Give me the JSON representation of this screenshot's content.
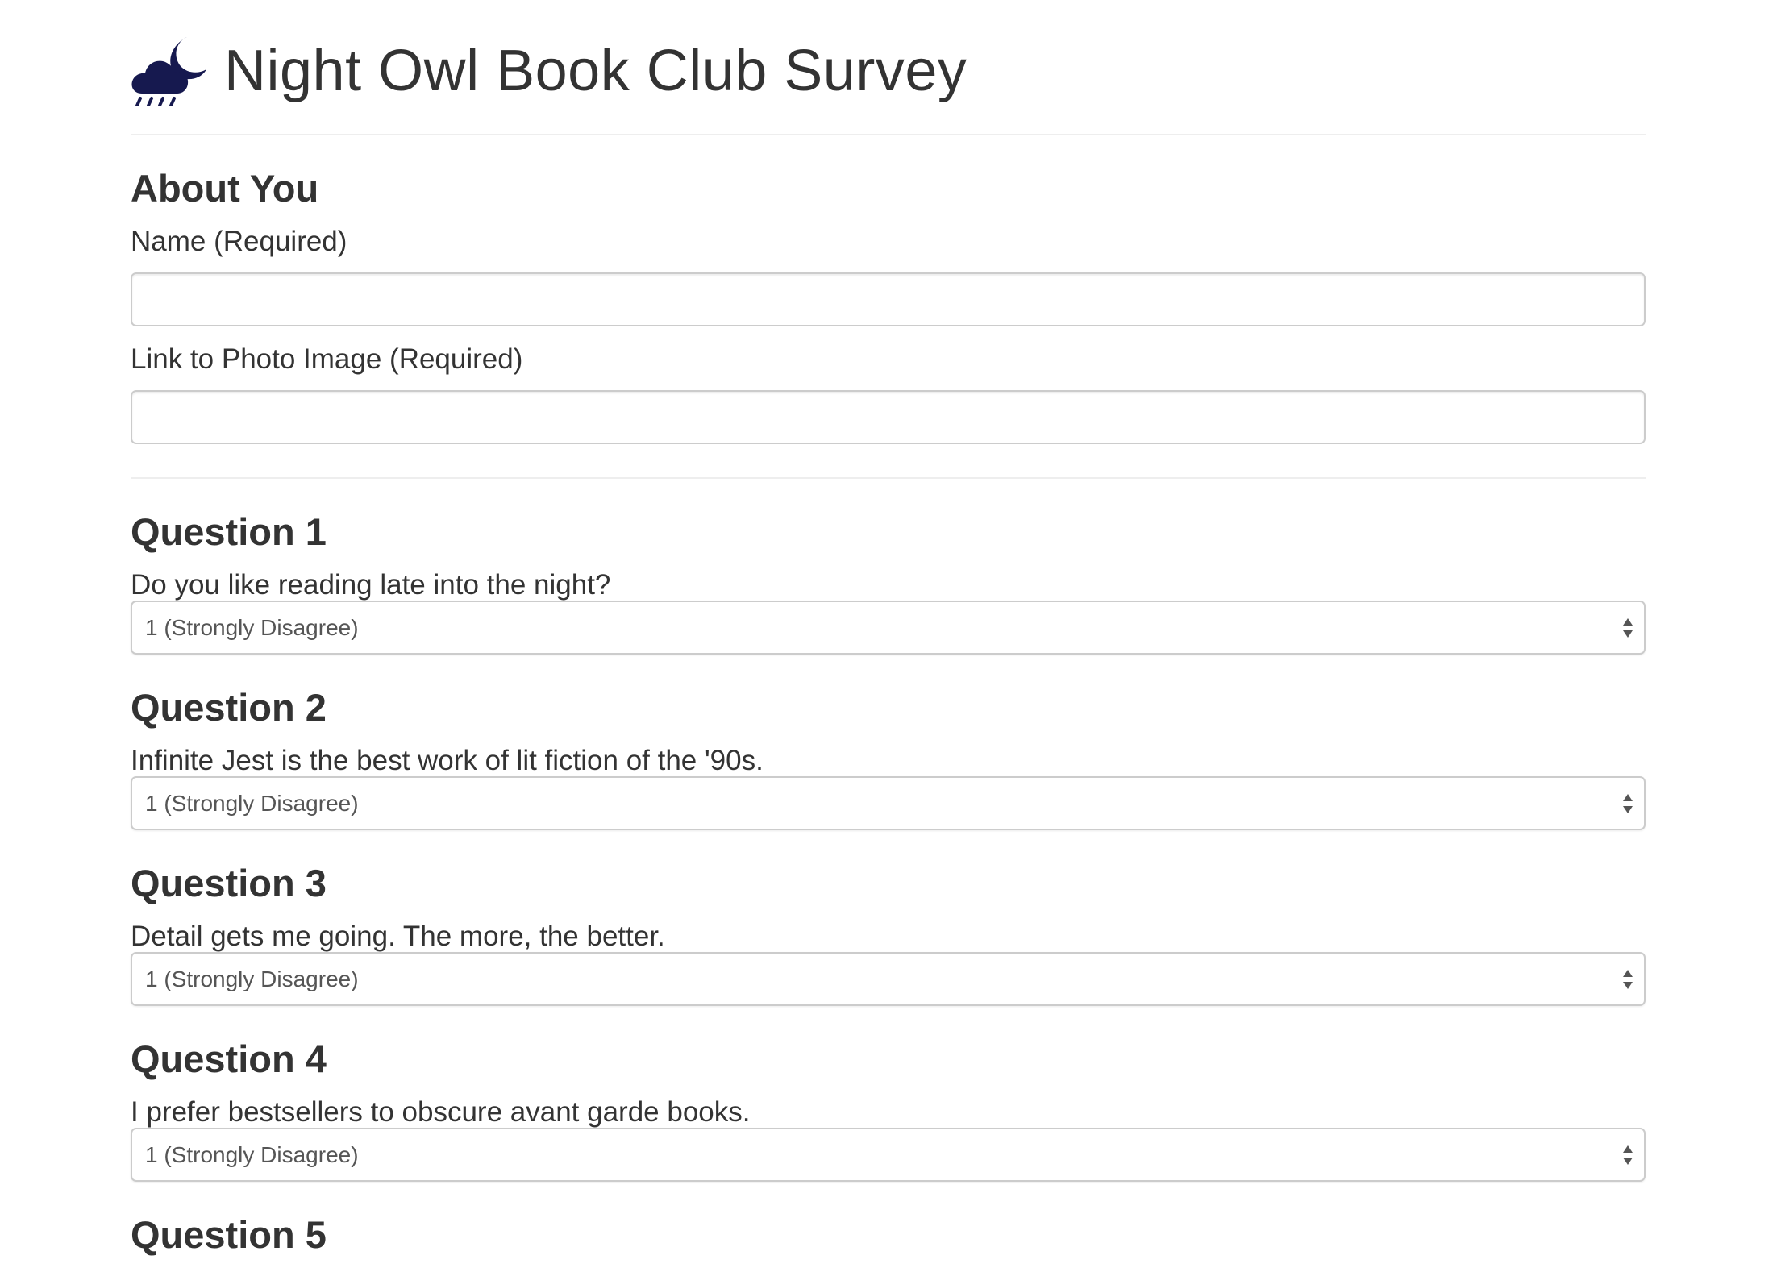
{
  "header": {
    "title": "Night Owl Book Club Survey",
    "logo_icon": "cloud-moon-rain-icon",
    "logo_color": "#16194f"
  },
  "about": {
    "heading": "About You",
    "name_label": "Name (Required)",
    "name_value": "",
    "photo_label": "Link to Photo Image (Required)",
    "photo_value": ""
  },
  "questions": [
    {
      "heading": "Question 1",
      "text": "Do you like reading late into the night?",
      "selected": "1 (Strongly Disagree)"
    },
    {
      "heading": "Question 2",
      "text": "Infinite Jest is the best work of lit fiction of the '90s.",
      "selected": "1 (Strongly Disagree)"
    },
    {
      "heading": "Question 3",
      "text": "Detail gets me going. The more, the better.",
      "selected": "1 (Strongly Disagree)"
    },
    {
      "heading": "Question 4",
      "text": "I prefer bestsellers to obscure avant garde books.",
      "selected": "1 (Strongly Disagree)"
    },
    {
      "heading": "Question 5"
    }
  ],
  "colors": {
    "text": "#333333",
    "input_border": "#cccccc",
    "divider": "#eeeeee",
    "logo": "#16194f"
  }
}
